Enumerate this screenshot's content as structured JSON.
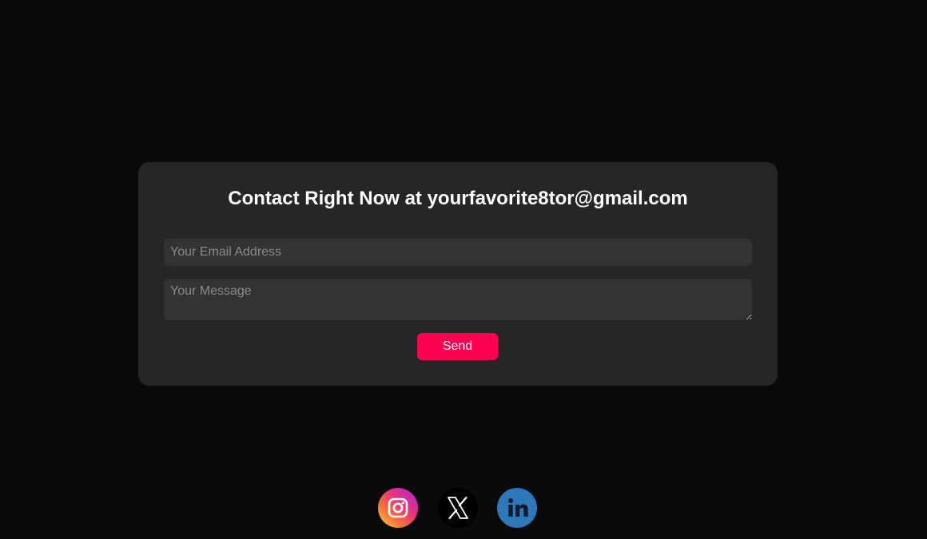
{
  "contact": {
    "title": "Contact Right Now at yourfavorite8tor@gmail.com",
    "email_placeholder": "Your Email Address",
    "email_value": "",
    "message_placeholder": "Your Message",
    "message_value": "",
    "send_label": "Send"
  },
  "social": [
    {
      "name": "instagram",
      "icon": "instagram-icon"
    },
    {
      "name": "x",
      "icon": "x-icon"
    },
    {
      "name": "linkedin",
      "icon": "linkedin-icon"
    }
  ],
  "colors": {
    "background": "#0a0a0a",
    "card": "#262626",
    "input": "#333333",
    "accent": "#ff0050",
    "linkedin": "#2d78b8"
  }
}
